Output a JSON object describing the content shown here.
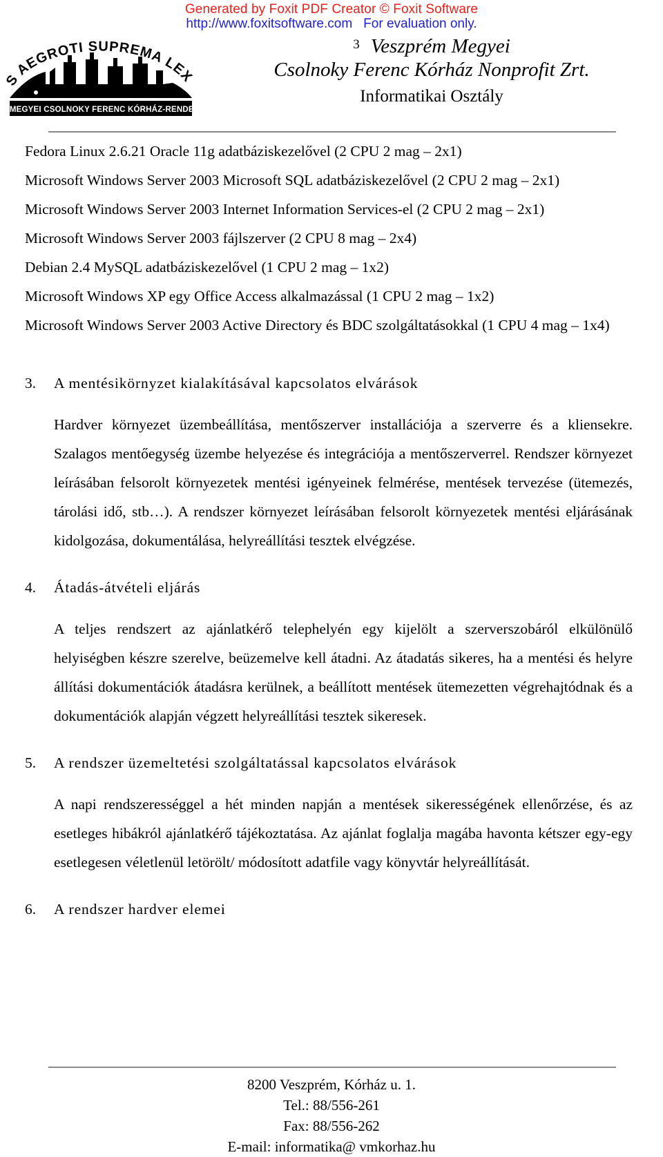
{
  "watermark": {
    "line1": "Generated by Foxit PDF Creator © Foxit Software",
    "url": "http://www.foxitsoftware.com",
    "eval": "For evaluation only."
  },
  "letterhead": {
    "logo_arc_text": "SALUS AEGROTI SUPREMA LEX ESTO",
    "logo_banner_text": "VESZPRÉM MEGYEI CSOLNOKY FERENC KÓRHÁZ-RENDELŐINTÉZET",
    "page_number": "3",
    "title_line1": "Veszprém Megyei",
    "title_line2": "Csolnoky Ferenc Kórház Nonprofit Zrt.",
    "department": "Informatikai Osztály"
  },
  "server_list": [
    "Fedora Linux 2.6.21 Oracle 11g adatbáziskezelővel (2 CPU 2 mag – 2x1)",
    "Microsoft Windows Server 2003 Microsoft SQL adatbáziskezelővel (2 CPU 2 mag – 2x1)",
    "Microsoft Windows Server 2003 Internet Information Services-el (2 CPU 2 mag – 2x1)",
    "Microsoft Windows Server 2003 fájlszerver (2 CPU 8 mag – 2x4)",
    "Debian 2.4 MySQL adatbáziskezelővel (1 CPU 2 mag – 1x2)",
    "Microsoft Windows XP egy Office Access alkalmazással (1 CPU 2 mag – 1x2)",
    "Microsoft Windows Server 2003 Active Directory és BDC szolgáltatásokkal (1 CPU 4 mag – 1x4)"
  ],
  "sections": [
    {
      "number": "3.",
      "title": "A mentésikörnyzet kialakításával kapcsolatos elvárások",
      "body": "Hardver környezet üzembeállítása, mentőszerver installációja a szerverre és a kliensekre. Szalagos mentőegység üzembe helyezése és integrációja a mentőszerverrel. Rendszer környezet leírásában felsorolt környezetek mentési igényeinek felmérése, mentések tervezése (ütemezés, tárolási idő, stb…). A rendszer környezet leírásában felsorolt környezetek mentési eljárásának kidolgozása, dokumentálása, helyreállítási tesztek elvégzése."
    },
    {
      "number": "4.",
      "title": "Átadás-átvételi eljárás",
      "body": "A teljes rendszert az ajánlatkérő telephelyén egy kijelölt a szerverszobáról elkülönülő helyiségben készre szerelve, beüzemelve kell átadni. Az átadatás sikeres, ha a mentési és helyre állítási dokumentációk átadásra kerülnek, a beállított mentések ütemezetten végrehajtódnak és a dokumentációk alapján végzett helyreállítási tesztek sikeresek."
    },
    {
      "number": "5.",
      "title": "A rendszer üzemeltetési szolgáltatással kapcsolatos elvárások",
      "body": "A napi rendszerességgel a hét minden napján a mentések sikerességének ellenőrzése, és az esetleges hibákról ajánlatkérő tájékoztatása. Az ajánlat foglalja magába havonta kétszer egy-egy esetlegesen véletlenül letörölt/ módosított adatfile vagy könyvtár helyreállítását."
    },
    {
      "number": "6.",
      "title": "A rendszer hardver elemei",
      "body": ""
    }
  ],
  "footer": {
    "address": "8200 Veszprém, Kórház u. 1.",
    "phone": "Tel.: 88/556-261",
    "fax": "Fax: 88/556-262",
    "email": "E-mail: informatika@ vmkorhaz.hu"
  }
}
